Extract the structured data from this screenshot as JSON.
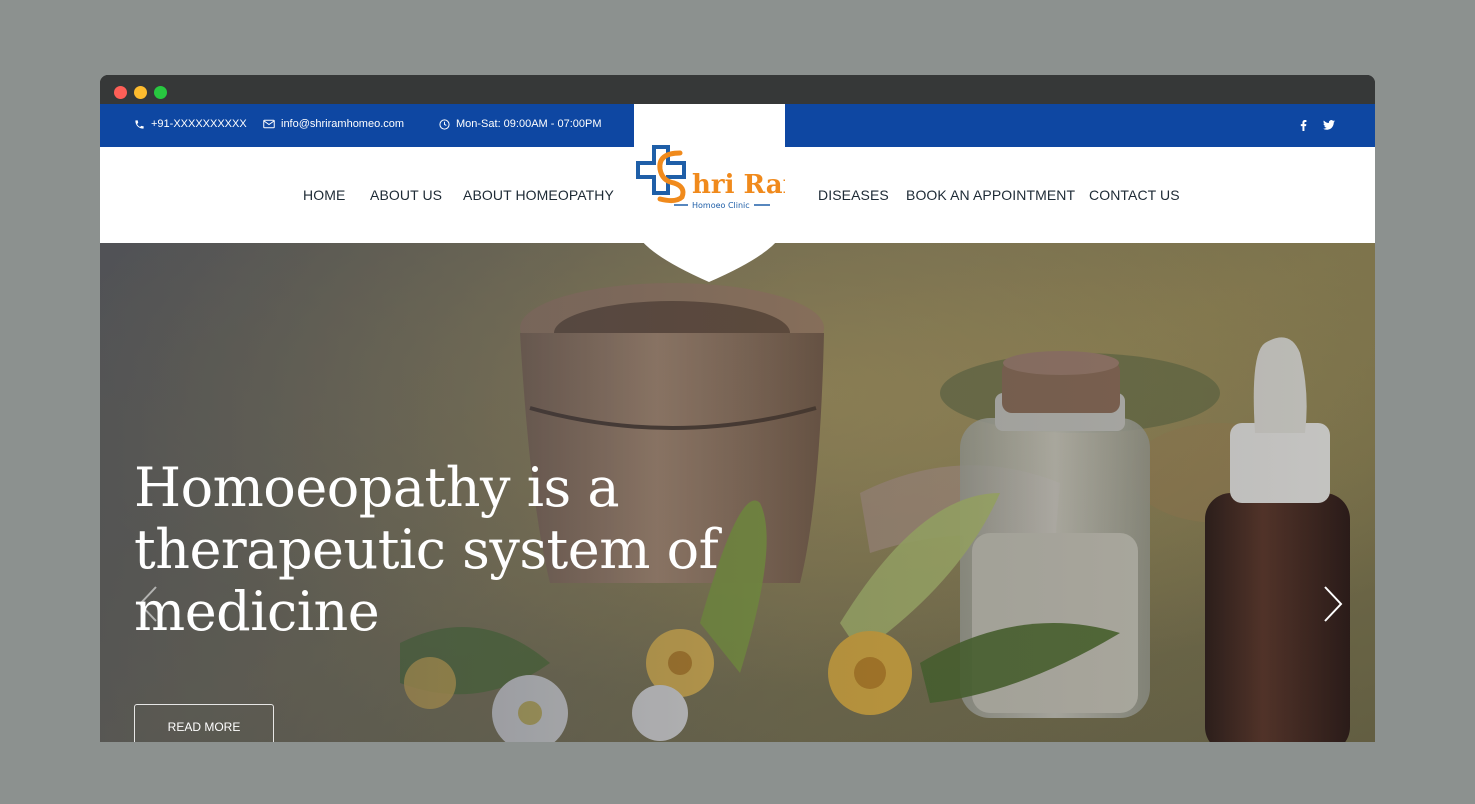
{
  "topbar": {
    "phone": "+91-XXXXXXXXXX",
    "email": "info@shriramhomeo.com",
    "hours": "Mon-Sat: 09:00AM - 07:00PM",
    "social": [
      {
        "icon": "facebook-icon",
        "label": "f"
      },
      {
        "icon": "twitter-icon",
        "label": "t"
      }
    ],
    "bg_color": "#0e47a2"
  },
  "logo": {
    "line1": "hri Ram",
    "line2": "Homoeo Clinic",
    "brand_orange": "#f08a1c",
    "brand_blue": "#1f5fa8"
  },
  "nav": {
    "left": [
      "HOME",
      "ABOUT US",
      "ABOUT HOMEOPATHY"
    ],
    "right": [
      "DISEASES",
      "BOOK AN APPOINTMENT",
      "CONTACT US"
    ]
  },
  "hero": {
    "title": "Homoeopathy is a therapeutic system of medicine",
    "button": "READ MORE"
  }
}
